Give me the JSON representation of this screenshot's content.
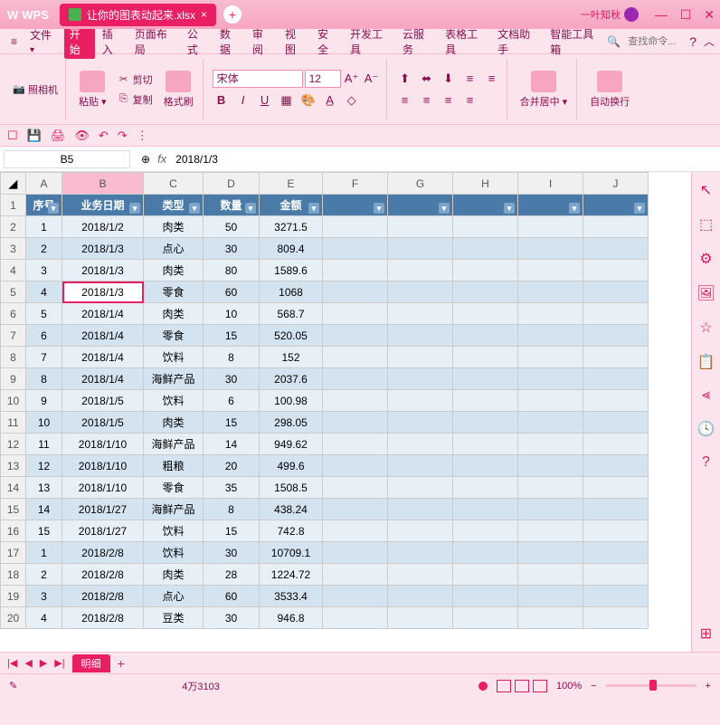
{
  "app": {
    "name": "WPS",
    "doc_title": "让你的图表动起来.xlsx",
    "user": "一叶知秋"
  },
  "menu": {
    "file": "文件",
    "start": "开始",
    "insert": "插入",
    "layout": "页面布局",
    "formula": "公式",
    "data": "数据",
    "review": "审阅",
    "view": "视图",
    "safety": "安全",
    "dev": "开发工具",
    "cloud": "云服务",
    "table_tools": "表格工具",
    "doc_helper": "文档助手",
    "smart_tools": "智能工具箱",
    "search_placeholder": "查找命令..."
  },
  "ribbon": {
    "camera": "照相机",
    "paste": "粘贴",
    "cut": "剪切",
    "copy": "复制",
    "format_painter": "格式刷",
    "font_name": "宋体",
    "font_size": "12",
    "merge_center": "合并居中",
    "auto_wrap": "自动换行"
  },
  "formula_bar": {
    "cell_ref": "B5",
    "value": "2018/1/3"
  },
  "columns": [
    "A",
    "B",
    "C",
    "D",
    "E",
    "F",
    "G",
    "H",
    "I",
    "J"
  ],
  "headers": {
    "seq": "序号",
    "date": "业务日期",
    "type": "类型",
    "qty": "数量",
    "amount": "金额"
  },
  "rows": [
    {
      "n": "1",
      "seq": "1",
      "date": "2018/1/2",
      "type": "肉类",
      "qty": "50",
      "amt": "3271.5"
    },
    {
      "n": "2",
      "seq": "2",
      "date": "2018/1/3",
      "type": "点心",
      "qty": "30",
      "amt": "809.4"
    },
    {
      "n": "3",
      "seq": "3",
      "date": "2018/1/3",
      "type": "肉类",
      "qty": "80",
      "amt": "1589.6"
    },
    {
      "n": "4",
      "seq": "4",
      "date": "2018/1/3",
      "type": "零食",
      "qty": "60",
      "amt": "1068"
    },
    {
      "n": "5",
      "seq": "5",
      "date": "2018/1/4",
      "type": "肉类",
      "qty": "10",
      "amt": "568.7"
    },
    {
      "n": "6",
      "seq": "6",
      "date": "2018/1/4",
      "type": "零食",
      "qty": "15",
      "amt": "520.05"
    },
    {
      "n": "7",
      "seq": "7",
      "date": "2018/1/4",
      "type": "饮料",
      "qty": "8",
      "amt": "152"
    },
    {
      "n": "8",
      "seq": "8",
      "date": "2018/1/4",
      "type": "海鲜产品",
      "qty": "30",
      "amt": "2037.6"
    },
    {
      "n": "9",
      "seq": "9",
      "date": "2018/1/5",
      "type": "饮料",
      "qty": "6",
      "amt": "100.98"
    },
    {
      "n": "10",
      "seq": "10",
      "date": "2018/1/5",
      "type": "肉类",
      "qty": "15",
      "amt": "298.05"
    },
    {
      "n": "11",
      "seq": "11",
      "date": "2018/1/10",
      "type": "海鲜产品",
      "qty": "14",
      "amt": "949.62"
    },
    {
      "n": "12",
      "seq": "12",
      "date": "2018/1/10",
      "type": "粗粮",
      "qty": "20",
      "amt": "499.6"
    },
    {
      "n": "13",
      "seq": "13",
      "date": "2018/1/10",
      "type": "零食",
      "qty": "35",
      "amt": "1508.5"
    },
    {
      "n": "14",
      "seq": "14",
      "date": "2018/1/27",
      "type": "海鲜产品",
      "qty": "8",
      "amt": "438.24"
    },
    {
      "n": "15",
      "seq": "15",
      "date": "2018/1/27",
      "type": "饮料",
      "qty": "15",
      "amt": "742.8"
    },
    {
      "n": "16",
      "seq": "1",
      "date": "2018/2/8",
      "type": "饮料",
      "qty": "30",
      "amt": "10709.1"
    },
    {
      "n": "17",
      "seq": "2",
      "date": "2018/2/8",
      "type": "肉类",
      "qty": "28",
      "amt": "1224.72"
    },
    {
      "n": "18",
      "seq": "3",
      "date": "2018/2/8",
      "type": "点心",
      "qty": "60",
      "amt": "3533.4"
    },
    {
      "n": "19",
      "seq": "4",
      "date": "2018/2/8",
      "type": "豆类",
      "qty": "30",
      "amt": "946.8"
    }
  ],
  "sheet_tabs": {
    "active": "明细"
  },
  "status": {
    "count": "4万3103",
    "zoom": "100%"
  }
}
